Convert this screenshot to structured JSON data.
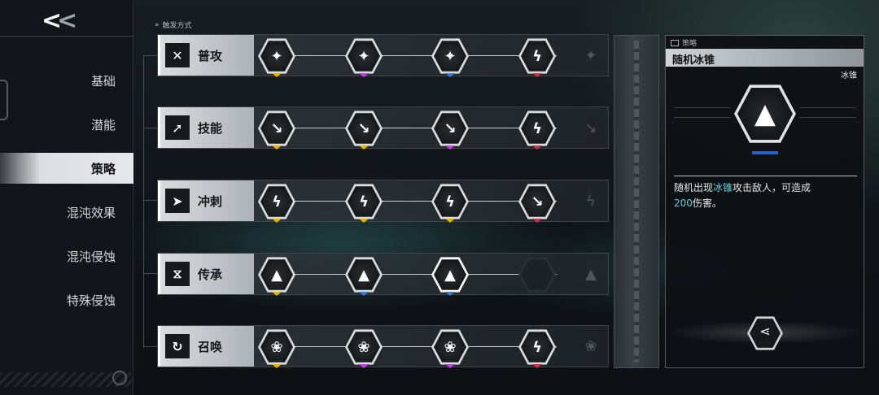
{
  "nav": {
    "back_icon": "double-chevron-left-icon",
    "items": [
      {
        "label": "基础"
      },
      {
        "label": "潜能"
      },
      {
        "label": "策略",
        "active": true
      },
      {
        "label": "混沌效果"
      },
      {
        "label": "混沌侵蚀"
      },
      {
        "label": "特殊侵蚀"
      }
    ]
  },
  "header": {
    "title": "触发方式"
  },
  "rows": [
    {
      "label": "普攻",
      "icon": "crossed-swords-icon",
      "tiers": [
        "#e8b400",
        "#c040e0",
        "#3a7bd5",
        "#d0304a"
      ]
    },
    {
      "label": "技能",
      "icon": "arrow-up-right-icon",
      "tiers": [
        "#e8b400",
        "#e8b400",
        "#c040e0",
        "#d0304a"
      ]
    },
    {
      "label": "冲刺",
      "icon": "dash-runner-icon",
      "tiers": [
        "#e8b400",
        "#e8b400",
        "#e8b400",
        "#d0304a"
      ]
    },
    {
      "label": "传承",
      "icon": "hourglass-helix-icon",
      "tiers": [
        "#e8b400",
        "#3a7bd5",
        "#3a7bd5",
        ""
      ]
    },
    {
      "label": "召唤",
      "icon": "summon-circle-icon",
      "tiers": [
        "#e8b400",
        "#c040e0",
        "#c040e0",
        "#d0304a"
      ]
    }
  ],
  "detail": {
    "category": "策略",
    "title": "随机冰锥",
    "tag": "冰锥",
    "tier_color": "#2f5fc4",
    "desc_1": "随机出现",
    "desc_hl1": "冰锥",
    "desc_2": "攻击敌人，可造成",
    "desc_hl2": "200",
    "desc_3": "伤害。",
    "share_icon": "share-icon"
  }
}
